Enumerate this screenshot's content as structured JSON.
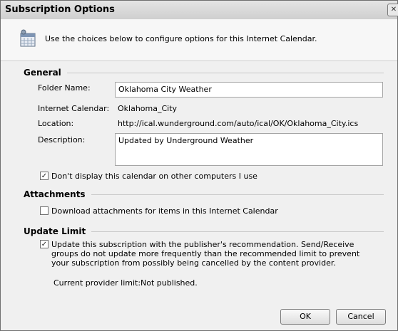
{
  "dialog": {
    "title": "Subscription Options",
    "close_glyph": "✕",
    "intro": "Use the choices below to configure options for this Internet Calendar."
  },
  "general": {
    "heading": "General",
    "folder_name_label": "Folder Name:",
    "folder_name_value": "Oklahoma City Weather",
    "internet_calendar_label": "Internet Calendar:",
    "internet_calendar_value": "Oklahoma_City",
    "location_label": "Location:",
    "location_value": "http://ical.wunderground.com/auto/ical/OK/Oklahoma_City.ics",
    "description_label": "Description:",
    "description_value": "Updated by Underground Weather",
    "dont_display_label": "Don't display this calendar on other computers I use",
    "dont_display_checked": true
  },
  "attachments": {
    "heading": "Attachments",
    "download_label": "Download attachments for items in this Internet Calendar",
    "download_checked": false
  },
  "update_limit": {
    "heading": "Update Limit",
    "recommendation_label": "Update this subscription with the publisher's recommendation. Send/Receive groups do not update more frequently than the recommended limit to prevent your subscription from possibly being cancelled by the content provider.",
    "recommendation_checked": true,
    "current_limit_label": "Current provider limit:",
    "current_limit_value": "Not published."
  },
  "buttons": {
    "ok": "OK",
    "cancel": "Cancel"
  },
  "check_glyph": "✓",
  "icons": {
    "calendar": "calendar-icon"
  }
}
